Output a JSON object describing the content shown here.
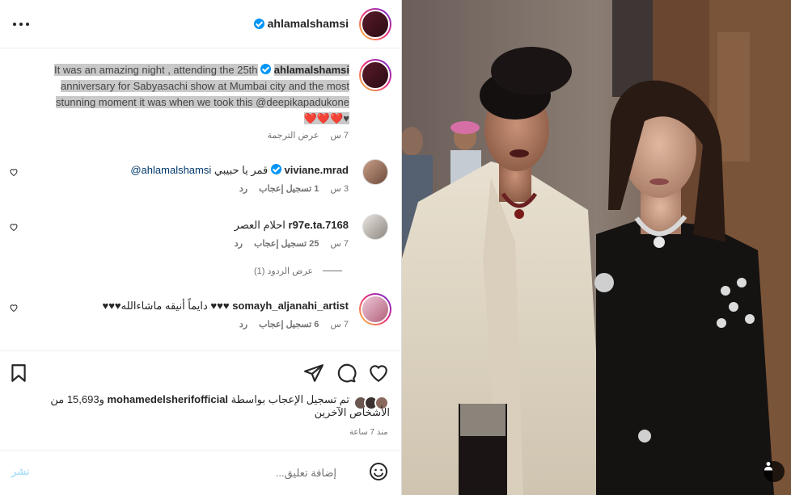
{
  "header": {
    "username": "ahlamalshamsi",
    "verified": true
  },
  "caption": {
    "username": "ahlamalshamsi",
    "text_line1": "It was an amazing night , attending the 25th",
    "text_line2": "anniversary for Sabyasachi show at Mumbai city and the most",
    "text_line3": "stunning moment it was when we took this @deepikapadukone",
    "text_line4": "❤️❤️❤️♥",
    "time": "7 س",
    "see_translation": "عرض الترجمة"
  },
  "comments": [
    {
      "username": "viviane.mrad",
      "verified": true,
      "text": "قمر يا حبيبي",
      "mention": "@ahlamalshamsi",
      "time": "3 س",
      "likes": "1 تسجيل إعجاب",
      "reply": "رد"
    },
    {
      "username": "r97e.ta.7168",
      "text": "احلام العصر",
      "time": "7 س",
      "likes": "25 تسجيل إعجاب",
      "reply": "رد",
      "view_replies": "عرض الردود (1)"
    },
    {
      "username": "somayh_aljanahi_artist",
      "text": "♥♥♥دايماً أنيقه ماشاءالله ♥♥♥",
      "time": "7 س",
      "likes": "6 تسجيل إعجاب",
      "reply": "رد"
    }
  ],
  "likes_summary": {
    "prefix": "تم تسجيل الإعجاب بواسطة",
    "username": "mohamedelsherifofficial",
    "rest": "و15,693 من الأشخاص الآخرين"
  },
  "time_ago": "منذ 7 ساعة",
  "comment_bar": {
    "placeholder": "إضافة تعليق...",
    "post_label": "نشر"
  },
  "icons": {
    "more": "more-options-icon",
    "heart": "heart-icon",
    "comment": "comment-icon",
    "share": "share-icon",
    "save": "bookmark-icon",
    "emoji": "emoji-icon",
    "tag": "user-tag-icon"
  },
  "colors": {
    "accent": "#0095f6",
    "text": "#262626",
    "muted": "#737373",
    "selection": "#c9c9c9"
  }
}
